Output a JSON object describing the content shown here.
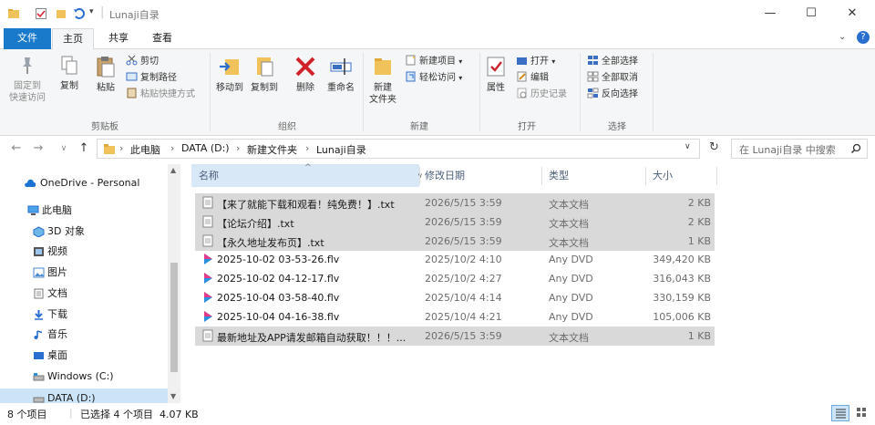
{
  "window": {
    "title": "Lunaji自录",
    "minimize": "—",
    "maximize": "☐",
    "close": "✕"
  },
  "tabs": {
    "file": "文件",
    "home": "主页",
    "share": "共享",
    "view": "查看"
  },
  "ribbon": {
    "clipboard": {
      "label": "剪贴板",
      "pin": "固定到\n快速访问",
      "copy": "复制",
      "paste": "粘贴",
      "cut": "剪切",
      "copy_path": "复制路径",
      "paste_shortcut": "粘贴快捷方式"
    },
    "organize": {
      "label": "组织",
      "move_to": "移动到",
      "copy_to": "复制到",
      "delete": "删除",
      "rename": "重命名"
    },
    "new": {
      "label": "新建",
      "new_folder": "新建\n文件夹",
      "new_item": "新建项目",
      "easy_access": "轻松访问"
    },
    "open": {
      "label": "打开",
      "properties": "属性",
      "open": "打开",
      "edit": "编辑",
      "history": "历史记录"
    },
    "select": {
      "label": "选择",
      "select_all": "全部选择",
      "select_none": "全部取消",
      "invert": "反向选择"
    }
  },
  "address": {
    "crumbs": [
      "此电脑",
      "DATA (D:)",
      "新建文件夹",
      "Lunaji自录"
    ],
    "search_placeholder": "在 Lunaji自录 中搜索"
  },
  "nav": {
    "items": [
      {
        "label": "OneDrive - Personal",
        "icon": "cloud-icon"
      },
      {
        "label": "此电脑",
        "icon": "computer-icon"
      },
      {
        "label": "3D 对象",
        "icon": "cube-icon"
      },
      {
        "label": "视频",
        "icon": "video-icon"
      },
      {
        "label": "图片",
        "icon": "picture-icon"
      },
      {
        "label": "文档",
        "icon": "document-icon"
      },
      {
        "label": "下载",
        "icon": "download-icon"
      },
      {
        "label": "音乐",
        "icon": "music-icon"
      },
      {
        "label": "桌面",
        "icon": "desktop-icon"
      },
      {
        "label": "Windows (C:)",
        "icon": "drive-icon"
      },
      {
        "label": "DATA (D:)",
        "icon": "drive-icon"
      }
    ]
  },
  "columns": {
    "name": "名称",
    "modified": "修改日期",
    "type": "类型",
    "size": "大小"
  },
  "files": [
    {
      "name": "【来了就能下载和观看！纯免费！】.txt",
      "modified": "2026/5/15 3:59",
      "type": "文本文档",
      "size": "2 KB",
      "selected": true,
      "kind": "txt"
    },
    {
      "name": "【论坛介绍】.txt",
      "modified": "2026/5/15 3:59",
      "type": "文本文档",
      "size": "2 KB",
      "selected": true,
      "kind": "txt"
    },
    {
      "name": "【永久地址发布页】.txt",
      "modified": "2026/5/15 3:59",
      "type": "文本文档",
      "size": "1 KB",
      "selected": true,
      "kind": "txt"
    },
    {
      "name": "2025-10-02 03-53-26.flv",
      "modified": "2025/10/2 4:10",
      "type": "Any DVD",
      "size": "349,420 KB",
      "selected": false,
      "kind": "flv"
    },
    {
      "name": "2025-10-02 04-12-17.flv",
      "modified": "2025/10/2 4:27",
      "type": "Any DVD",
      "size": "316,043 KB",
      "selected": false,
      "kind": "flv"
    },
    {
      "name": "2025-10-04 03-58-40.flv",
      "modified": "2025/10/4 4:14",
      "type": "Any DVD",
      "size": "330,159 KB",
      "selected": false,
      "kind": "flv"
    },
    {
      "name": "2025-10-04 04-16-38.flv",
      "modified": "2025/10/4 4:21",
      "type": "Any DVD",
      "size": "105,006 KB",
      "selected": false,
      "kind": "flv"
    },
    {
      "name": "最新地址及APP请发邮箱自动获取！！！...",
      "modified": "2026/5/15 3:59",
      "type": "文本文档",
      "size": "1 KB",
      "selected": true,
      "kind": "txt"
    }
  ],
  "status": {
    "count": "8 个项目",
    "selection": "已选择 4 个项目  4.07 KB"
  },
  "colors": {
    "file_tab": "#1979ca",
    "selection": "#d9d9d9",
    "header_text": "#4c607a"
  }
}
